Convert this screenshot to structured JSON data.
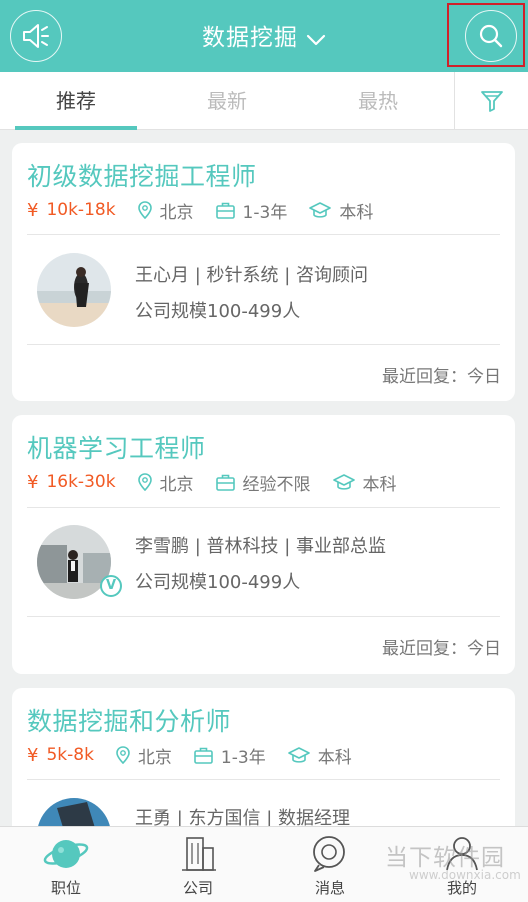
{
  "header": {
    "title": "数据挖掘"
  },
  "tabs": [
    {
      "label": "推荐"
    },
    {
      "label": "最新"
    },
    {
      "label": "最热"
    }
  ],
  "jobs": [
    {
      "title": "初级数据挖掘工程师",
      "salary": "10k-18k",
      "city": "北京",
      "experience": "1-3年",
      "education": "本科",
      "recruiter": "王心月 | 秒针系统 | 咨询顾问",
      "company_size": "公司规模100-499人",
      "last_reply": "最近回复：今日"
    },
    {
      "title": "机器学习工程师",
      "salary": "16k-30k",
      "city": "北京",
      "experience": "经验不限",
      "education": "本科",
      "recruiter": "李雪鹏 | 普林科技 | 事业部总监",
      "company_size": "公司规模100-499人",
      "last_reply": "最近回复：今日",
      "verified_badge": "V"
    },
    {
      "title": "数据挖掘和分析师",
      "salary": "5k-8k",
      "city": "北京",
      "experience": "1-3年",
      "education": "本科",
      "recruiter": "王勇 | 东方国信 | 数据经理"
    }
  ],
  "currency_symbol": "¥",
  "bottom_nav": [
    {
      "label": "职位",
      "icon": "planet-icon"
    },
    {
      "label": "公司",
      "icon": "building-icon"
    },
    {
      "label": "消息",
      "icon": "chat-bubble-icon"
    },
    {
      "label": "我的",
      "icon": "user-icon"
    }
  ],
  "watermark": {
    "text": "当下软件园",
    "url": "www.downxia.com"
  },
  "colors": {
    "accent": "#55c8be",
    "salary": "#f15a24",
    "highlight_box": "#d0202a"
  }
}
